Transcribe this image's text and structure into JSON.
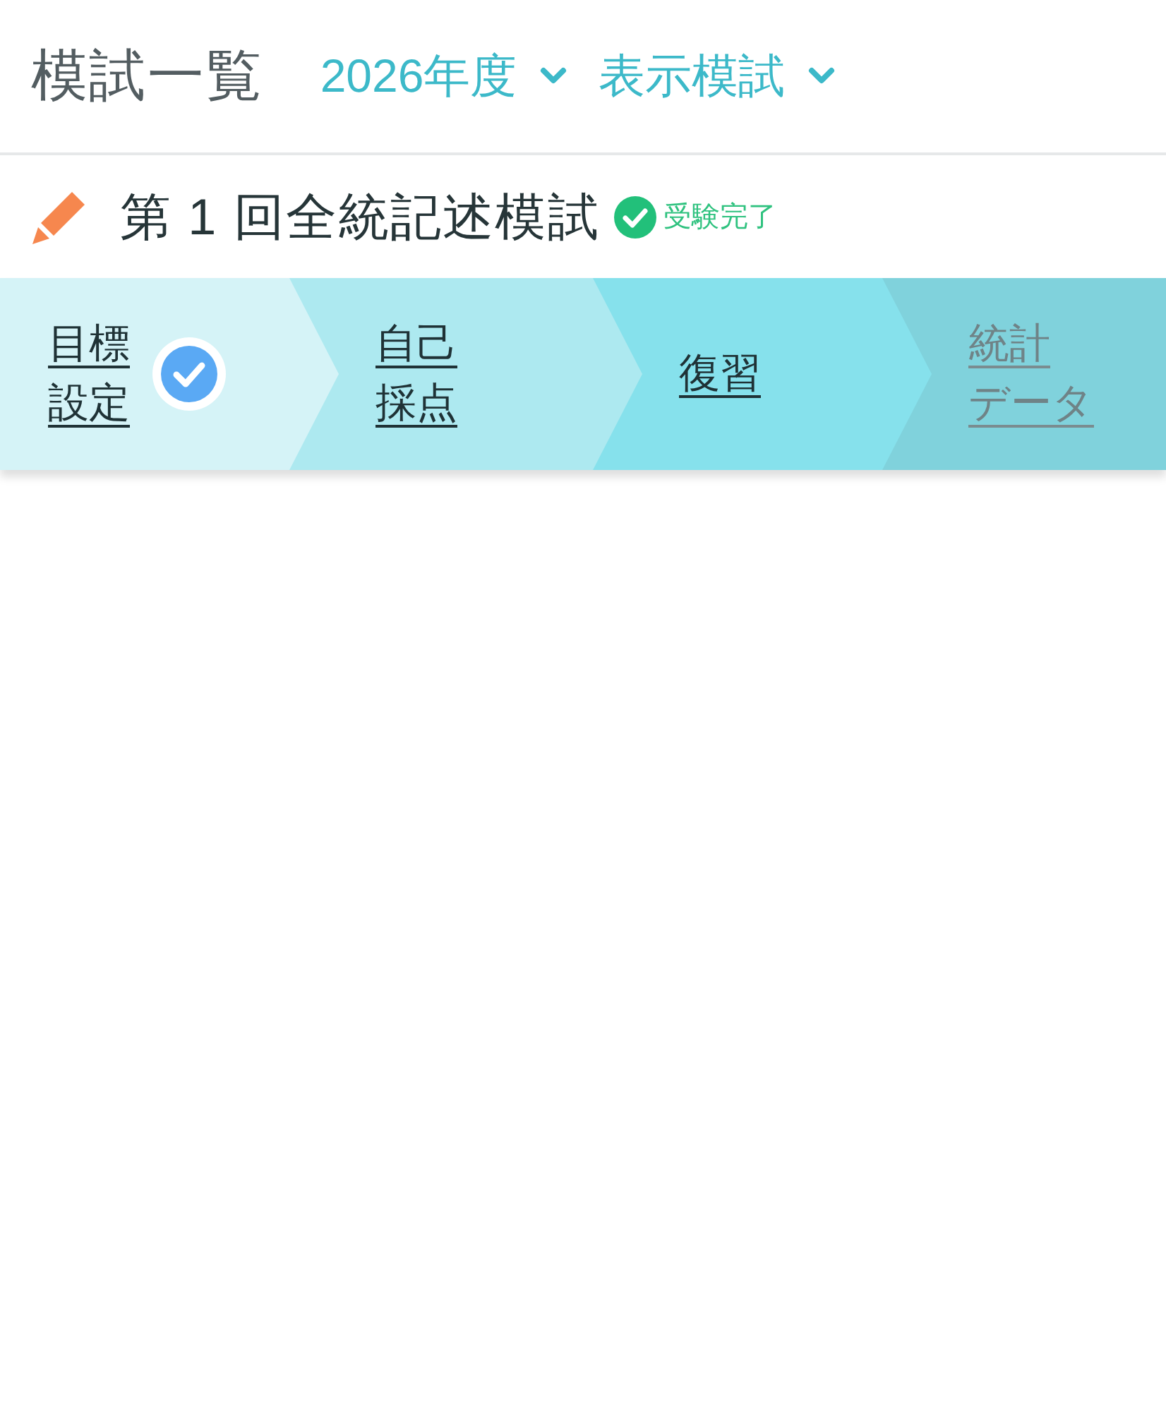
{
  "header": {
    "title": "模試一覧",
    "filters": [
      {
        "label": "2026年度"
      },
      {
        "label": "表示模試"
      }
    ]
  },
  "exam": {
    "title": "第 1 回全統記述模試",
    "status": {
      "label": "受験完了",
      "completed": true
    }
  },
  "steps": [
    {
      "label_lines": [
        "目標",
        "設定"
      ],
      "completed": true,
      "disabled": false
    },
    {
      "label_lines": [
        "自己",
        "採点"
      ],
      "completed": false,
      "disabled": false
    },
    {
      "label_lines": [
        "復習"
      ],
      "completed": false,
      "disabled": false
    },
    {
      "label_lines": [
        "統計",
        "データ"
      ],
      "completed": false,
      "disabled": true
    }
  ]
}
